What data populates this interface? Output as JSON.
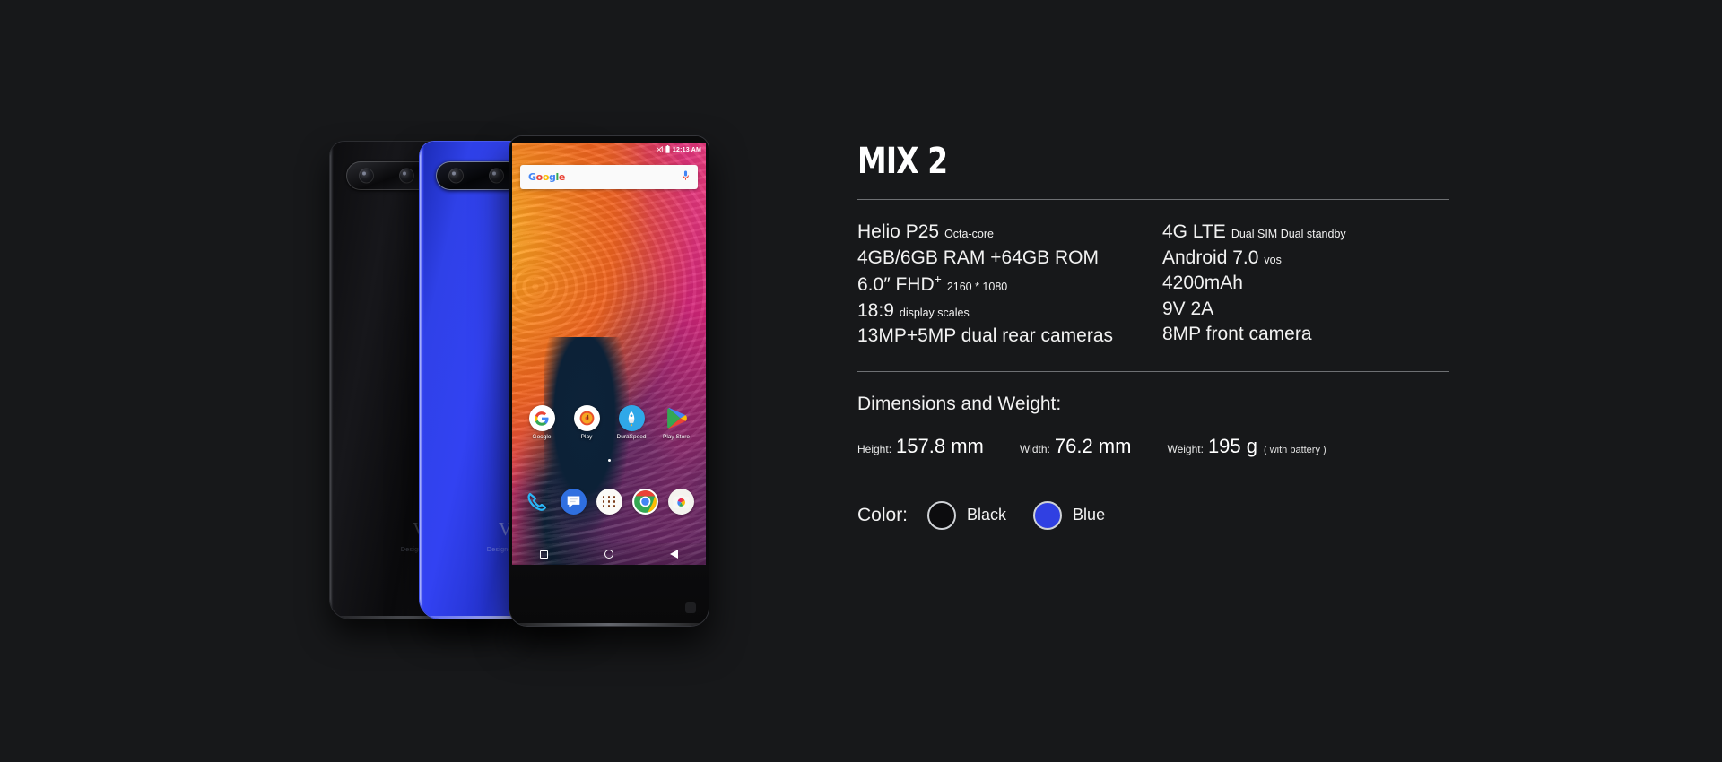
{
  "product": {
    "title": "MIX 2",
    "brand_mark": "V",
    "brand_sub": "Designed by"
  },
  "specs": {
    "left": [
      {
        "main": "Helio P25",
        "small": "Octa-core"
      },
      {
        "main": "4GB/6GB RAM +64GB ROM",
        "small": ""
      },
      {
        "main": "6.0″  FHD",
        "sup": "+",
        "small": "2160 * 1080"
      },
      {
        "main": "18:9",
        "small": "display scales"
      },
      {
        "main": "13MP+5MP dual rear cameras",
        "small": ""
      }
    ],
    "right": [
      {
        "main": "4G LTE",
        "small": "Dual SIM Dual standby"
      },
      {
        "main": "Android 7.0",
        "small": "vos"
      },
      {
        "main": "4200mAh",
        "small": ""
      },
      {
        "main": "9V 2A",
        "small": ""
      },
      {
        "main": "8MP front camera",
        "small": ""
      }
    ]
  },
  "dimensions": {
    "heading": "Dimensions and Weight:",
    "items": [
      {
        "key": "Height:",
        "value": "157.8 mm"
      },
      {
        "key": "Width:",
        "value": "76.2 mm"
      },
      {
        "key": "Weight:",
        "value": "195 g"
      }
    ],
    "note": "( with battery )"
  },
  "colors": {
    "label": "Color:",
    "options": [
      {
        "name": "Black",
        "hex": "#0c0c0e"
      },
      {
        "name": "Blue",
        "hex": "#3040e2"
      }
    ]
  },
  "phone_screen": {
    "status": {
      "time": "12:13 AM",
      "signal_icon": "signal-off-icon",
      "battery_icon": "battery-icon"
    },
    "search_widget": {
      "logo_letters": [
        "G",
        "o",
        "o",
        "g",
        "l",
        "e"
      ],
      "mic_icon": "microphone-icon"
    },
    "apps": [
      {
        "label": "Google",
        "icon": "google-icon"
      },
      {
        "label": "Play",
        "icon": "play-music-icon"
      },
      {
        "label": "DuraSpeed",
        "icon": "duraspeed-icon"
      },
      {
        "label": "Play Store",
        "icon": "play-store-icon"
      }
    ],
    "dock": [
      {
        "label": "Phone",
        "icon": "phone-icon"
      },
      {
        "label": "Messages",
        "icon": "messages-icon"
      },
      {
        "label": "All apps",
        "icon": "app-drawer-icon"
      },
      {
        "label": "Chrome",
        "icon": "chrome-icon"
      },
      {
        "label": "Camera",
        "icon": "camera-icon"
      }
    ],
    "navbar": [
      {
        "name": "recents-button",
        "icon": "square-icon"
      },
      {
        "name": "home-button",
        "icon": "circle-icon"
      },
      {
        "name": "back-button",
        "icon": "triangle-back-icon"
      }
    ]
  }
}
